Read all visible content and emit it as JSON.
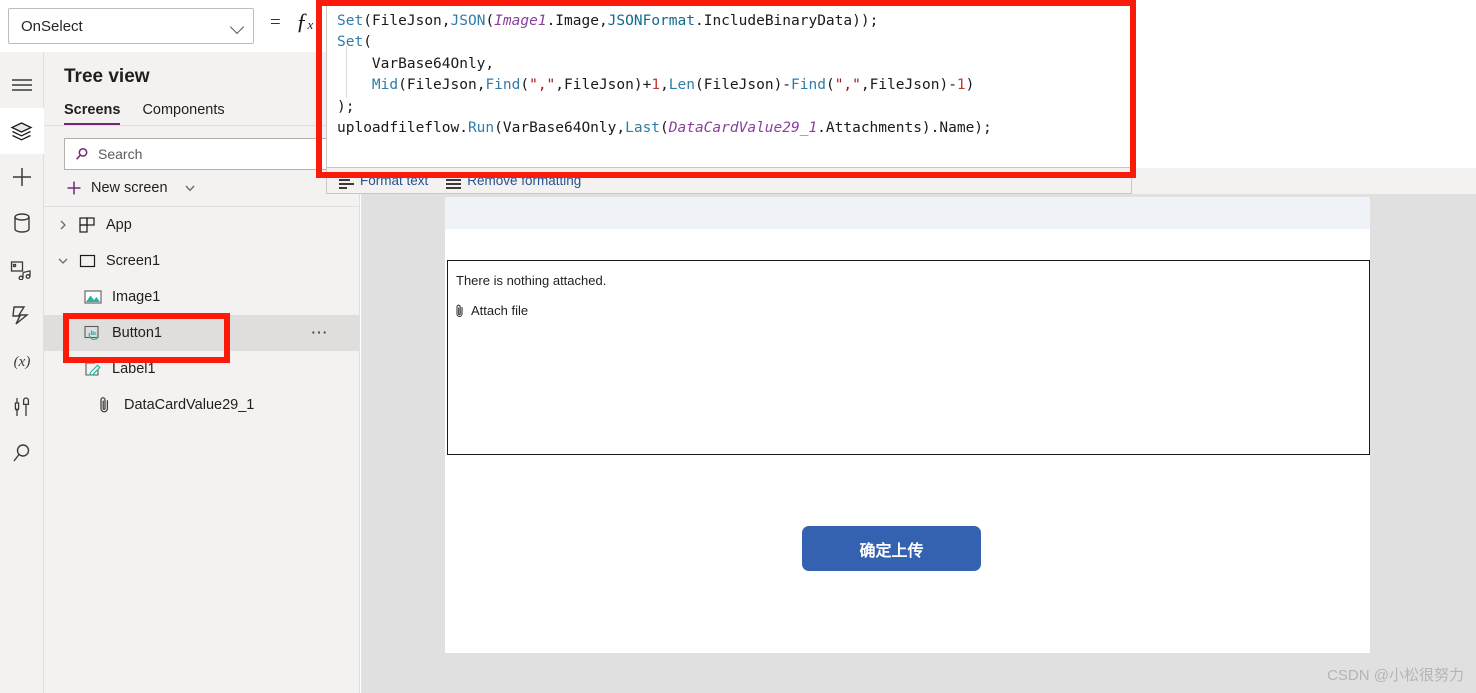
{
  "formula_bar": {
    "property_label": "OnSelect",
    "equals": "=",
    "fx": "fx",
    "code_lines": [
      {
        "segments": [
          {
            "t": "Set",
            "c": "fn"
          },
          {
            "t": "(",
            "c": "plain"
          },
          {
            "t": "FileJson",
            "c": "plain"
          },
          {
            "t": ",",
            "c": "plain"
          },
          {
            "t": "JSON",
            "c": "fn"
          },
          {
            "t": "(",
            "c": "plain"
          },
          {
            "t": "Image1",
            "c": "ctrl"
          },
          {
            "t": ".Image,",
            "c": "plain"
          },
          {
            "t": "JSONFormat",
            "c": "enm"
          },
          {
            "t": ".IncludeBinaryData));",
            "c": "plain"
          }
        ]
      },
      {
        "segments": [
          {
            "t": "Set",
            "c": "fn"
          },
          {
            "t": "(",
            "c": "plain"
          }
        ]
      },
      {
        "segments": [
          {
            "t": "    VarBase64Only,",
            "c": "plain"
          }
        ]
      },
      {
        "segments": [
          {
            "t": "    ",
            "c": "plain"
          },
          {
            "t": "Mid",
            "c": "fn"
          },
          {
            "t": "(FileJson,",
            "c": "plain"
          },
          {
            "t": "Find",
            "c": "fn"
          },
          {
            "t": "(",
            "c": "plain"
          },
          {
            "t": "\",\"",
            "c": "str"
          },
          {
            "t": ",FileJson)+",
            "c": "plain"
          },
          {
            "t": "1",
            "c": "num"
          },
          {
            "t": ",",
            "c": "plain"
          },
          {
            "t": "Len",
            "c": "fn"
          },
          {
            "t": "(FileJson)-",
            "c": "plain"
          },
          {
            "t": "Find",
            "c": "fn"
          },
          {
            "t": "(",
            "c": "plain"
          },
          {
            "t": "\",\"",
            "c": "str"
          },
          {
            "t": ",FileJson)-",
            "c": "plain"
          },
          {
            "t": "1",
            "c": "num"
          },
          {
            "t": ")",
            "c": "plain"
          }
        ]
      },
      {
        "segments": [
          {
            "t": ");",
            "c": "plain"
          }
        ]
      },
      {
        "segments": [
          {
            "t": "uploadfileflow.",
            "c": "plain"
          },
          {
            "t": "Run",
            "c": "fn"
          },
          {
            "t": "(VarBase64Only,",
            "c": "plain"
          },
          {
            "t": "Last",
            "c": "fn"
          },
          {
            "t": "(",
            "c": "plain"
          },
          {
            "t": "DataCardValue29_1",
            "c": "ctrl"
          },
          {
            "t": ".Attachments).Name);",
            "c": "plain"
          }
        ]
      }
    ],
    "format_text_label": "Format text",
    "remove_formatting_label": "Remove formatting"
  },
  "rail": {
    "items": [
      {
        "icon": "hamburger-menu-icon",
        "name": "menu",
        "active": false
      },
      {
        "icon": "layers-tree-view-icon",
        "name": "tree-view",
        "active": true
      },
      {
        "icon": "plus-insert-icon",
        "name": "insert",
        "active": false
      },
      {
        "icon": "database-data-icon",
        "name": "data",
        "active": false
      },
      {
        "icon": "media-icon",
        "name": "media",
        "active": false
      },
      {
        "icon": "power-automate-icon",
        "name": "power-automate",
        "active": false
      },
      {
        "icon": "variables-x-icon",
        "name": "variables",
        "active": false
      },
      {
        "icon": "tools-icon",
        "name": "tools",
        "active": false
      },
      {
        "icon": "search-icon",
        "name": "search",
        "active": false
      }
    ]
  },
  "tree_view": {
    "title": "Tree view",
    "tabs": [
      {
        "label": "Screens",
        "active": true
      },
      {
        "label": "Components",
        "active": false
      }
    ],
    "search_placeholder": "Search",
    "new_screen_label": "New screen",
    "items": [
      {
        "label": "App",
        "icon": "app-grid-icon",
        "twist": "chevron-right",
        "level": 0,
        "selected": false,
        "menu": false
      },
      {
        "label": "Screen1",
        "icon": "screen-rect-icon",
        "twist": "chevron-down",
        "level": 0,
        "selected": false,
        "menu": false
      },
      {
        "label": "Image1",
        "icon": "image-icon",
        "twist": "",
        "level": 1,
        "selected": false,
        "menu": false
      },
      {
        "label": "Button1",
        "icon": "button-cursor-icon",
        "twist": "",
        "level": 1,
        "selected": true,
        "menu": true,
        "menu_label": "⋯"
      },
      {
        "label": "Label1",
        "icon": "label-pencil-icon",
        "twist": "",
        "level": 1,
        "selected": false,
        "menu": false
      },
      {
        "label": "DataCardValue29_1",
        "icon": "attachment-paperclip-icon",
        "twist": "",
        "level": 1,
        "selected": false,
        "menu": false
      }
    ]
  },
  "canvas": {
    "attachment": {
      "empty_message": "There is nothing attached.",
      "attach_file_label": "Attach file"
    },
    "upload_button_label": "确定上传"
  },
  "watermark": "CSDN @小松很努力",
  "colors": {
    "accent_purple": "#742774",
    "annotation_red": "#fc1b0b",
    "button_blue": "#3461b0",
    "panel_gray": "#f3f2f1",
    "canvas_gray": "#e0e0e0",
    "screen_band": "#eff3f8"
  }
}
